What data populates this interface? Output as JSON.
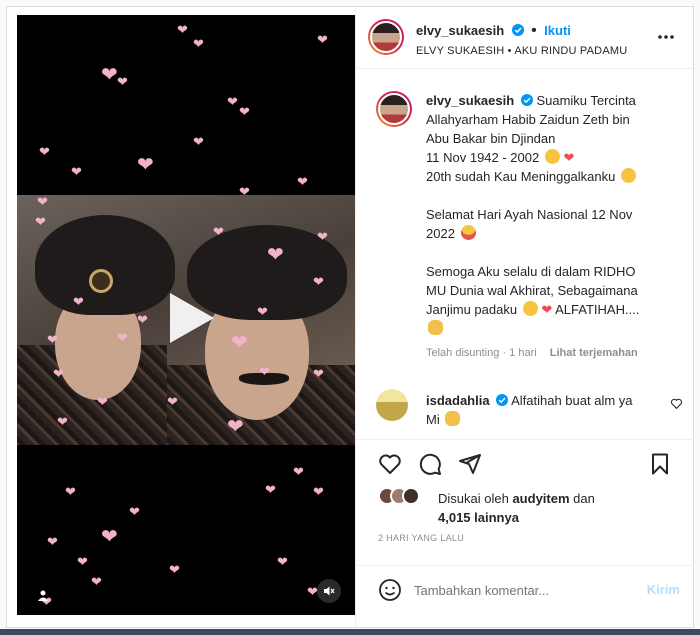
{
  "post": {
    "username": "elvy_sukaesih",
    "follow_label": "Ikuti",
    "audio_line": "ELVY SUKAESIH • AKU RINDU PADAMU"
  },
  "caption": {
    "lines": [
      "Suamiku Tercinta",
      "Allahyarham Habib Zaidun Zeth bin",
      "Abu Bakar bin Djindan",
      "11 Nov 1942 - 2002",
      "20th sudah Kau Meninggalkanku",
      "Selamat Hari Ayah Nasional 12 Nov",
      "2022",
      "Semoga Aku selalu di dalam RIDHO",
      "MU Dunia wal Akhirat, Sebagaimana",
      "Janjimu padaku",
      "ALFATIHAH...."
    ],
    "edited": "Telah disunting · 1 hari",
    "translate": "Lihat terjemahan"
  },
  "comment": {
    "username": "isdadahlia",
    "text_line1": "Alfatihah buat alm ya",
    "text_line2": "Mi"
  },
  "likes": {
    "prefix": "Disukai oleh",
    "user": "audyitem",
    "and": "dan",
    "count": "4,015 lainnya"
  },
  "timestamp": "2 HARI YANG LALU",
  "composer": {
    "placeholder": "Tambahkan komentar...",
    "post_label": "Kirim"
  },
  "colors": {
    "accent": "#0095f6",
    "like_heart": "#ed4956",
    "media_bg": "#000000"
  }
}
